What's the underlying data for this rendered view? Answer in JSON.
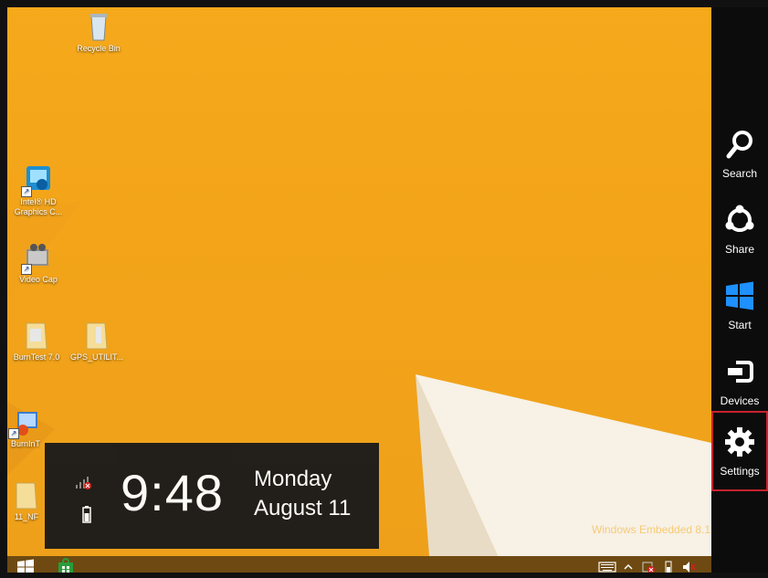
{
  "desktop": {
    "icons": [
      {
        "label": "Recycle Bin",
        "icon": "recycle-bin-icon"
      },
      {
        "label": "Intel® HD Graphics C...",
        "icon": "intel-graphics-icon"
      },
      {
        "label": "Video Cap",
        "icon": "video-capture-icon"
      },
      {
        "label": "BurnTest 7.0",
        "icon": "folder-icon"
      },
      {
        "label": "GPS_UTILIT...",
        "icon": "folder-icon"
      },
      {
        "label": "BurnInT",
        "icon": "burnin-test-icon"
      },
      {
        "label": "11_NF",
        "icon": "folder-icon"
      }
    ],
    "watermark": "Windows Embedded 8.1"
  },
  "charms": {
    "items": [
      {
        "label": "Search",
        "icon": "search-icon"
      },
      {
        "label": "Share",
        "icon": "share-icon"
      },
      {
        "label": "Start",
        "icon": "windows-logo-icon"
      },
      {
        "label": "Devices",
        "icon": "devices-icon"
      },
      {
        "label": "Settings",
        "icon": "gear-icon",
        "selected": true
      }
    ]
  },
  "clock": {
    "time": "9:48",
    "day": "Monday",
    "date": "August 11",
    "status_icons": [
      "no-signal-icon",
      "battery-icon"
    ]
  },
  "taskbar": {
    "items": [
      "start-button-icon",
      "store-icon"
    ],
    "tray": [
      "keyboard-icon",
      "tray-chevron-icon",
      "network-error-icon",
      "battery-icon",
      "volume-icon"
    ]
  },
  "colors": {
    "desktop": "#f3a419",
    "charms_bg": "#0c0c0c",
    "selected_border": "#c8222e",
    "clock_bg": "#1a1a1a"
  }
}
